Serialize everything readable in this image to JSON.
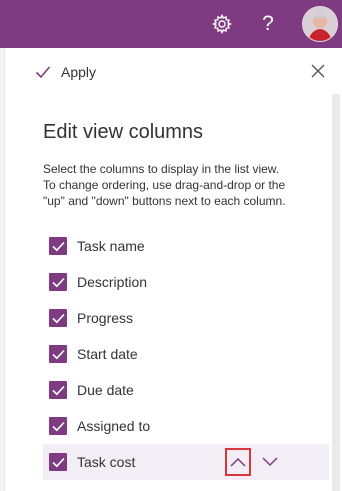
{
  "apply_label": "Apply",
  "header": {
    "help_glyph": "?"
  },
  "panel": {
    "title": "Edit view columns",
    "description": "Select the columns to display in the list view. To change ordering, use drag-and-drop or the \"up\" and \"down\" buttons next to each column."
  },
  "columns": [
    {
      "label": "Task name",
      "checked": true
    },
    {
      "label": "Description",
      "checked": true
    },
    {
      "label": "Progress",
      "checked": true
    },
    {
      "label": "Start date",
      "checked": true
    },
    {
      "label": "Due date",
      "checked": true
    },
    {
      "label": "Assigned to",
      "checked": true
    },
    {
      "label": "Task cost",
      "checked": true
    }
  ],
  "colors": {
    "brand": "#7e3b82",
    "highlight": "#d9363e"
  },
  "icons": [
    "gear-icon",
    "help-icon",
    "avatar",
    "checkmark-icon",
    "close-icon",
    "chevron-up-icon",
    "chevron-down-icon"
  ]
}
